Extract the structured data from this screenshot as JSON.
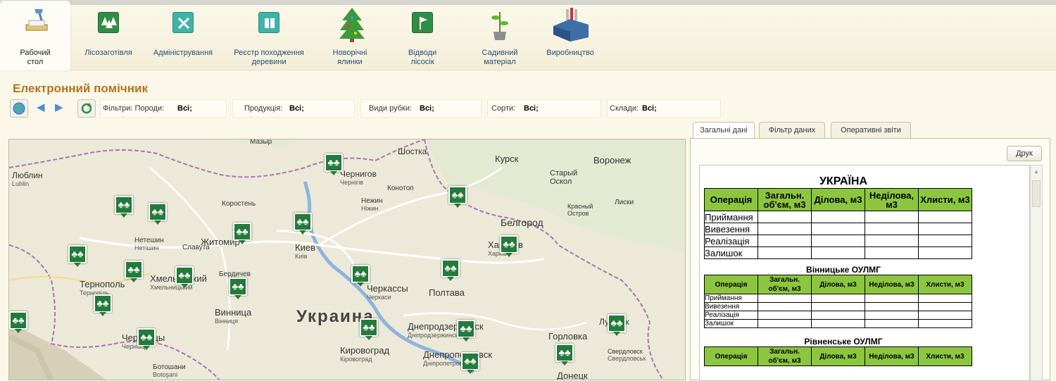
{
  "toolbar": [
    {
      "label": "Рабочий\nстол",
      "icon": "desk-lamp-icon"
    },
    {
      "label": "Лісозаготівля",
      "icon": "forest-icon"
    },
    {
      "label": "Адміністрування",
      "icon": "tools-icon"
    },
    {
      "label": "Реєстр походження\nдеревини",
      "icon": "registry-icon"
    },
    {
      "label": "Новорічні\nялинки",
      "icon": "christmas-tree-icon"
    },
    {
      "label": "Відводи\nлісосік",
      "icon": "flag-icon"
    },
    {
      "label": "Садивний\nматеріал",
      "icon": "seedling-icon"
    },
    {
      "label": "Виробництво",
      "icon": "factory-icon"
    }
  ],
  "title": "Електронний помічник",
  "filters": {
    "label_poroda": "Фільтри: Породи:",
    "value_poroda": "Всі;",
    "label_produkcia": "Продукція:",
    "value_produkcia": "Всі;",
    "label_rubky": "Види рубки:",
    "value_rubky": "Всі;",
    "label_sorty": "Сорти:",
    "value_sorty": "Всі;",
    "label_sklady": "Склади:",
    "value_sklady": "Всі;"
  },
  "tabs": [
    "Загальні дані",
    "Фільтр даних",
    "Оперативні звіти"
  ],
  "print_button": "Друк",
  "report": {
    "country": "УКРАЇНА",
    "headers": [
      "Операція",
      "Загальн. об'єм, м3",
      "Ділова, м3",
      "Неділова, м3",
      "Хлисти, м3"
    ],
    "rows": [
      "Приймання",
      "Вивезення",
      "Реалізація",
      "Залишок"
    ],
    "regions": [
      "Вінницьке ОУЛМГ",
      "Рівненське ОУЛМГ"
    ]
  },
  "map": {
    "country_label": "Украина",
    "cities": [
      {
        "name": "Люблин",
        "sub": "Lublin"
      },
      {
        "name": "Чернигов",
        "sub": "Чернігів"
      },
      {
        "name": "Шостка",
        "sub": ""
      },
      {
        "name": "Курск",
        "sub": ""
      },
      {
        "name": "Воронеж",
        "sub": ""
      },
      {
        "name": "Старый Оскол",
        "sub": ""
      },
      {
        "name": "Конотоп",
        "sub": ""
      },
      {
        "name": "Нежин",
        "sub": "Ніжин"
      },
      {
        "name": "Коростень",
        "sub": ""
      },
      {
        "name": "Красный Остров",
        "sub": ""
      },
      {
        "name": "Лиски",
        "sub": ""
      },
      {
        "name": "Белгород",
        "sub": ""
      },
      {
        "name": "Нетешин",
        "sub": "Нетішин"
      },
      {
        "name": "Славута",
        "sub": ""
      },
      {
        "name": "Житомир",
        "sub": ""
      },
      {
        "name": "Киев",
        "sub": "Київ"
      },
      {
        "name": "Харьков",
        "sub": "Харків"
      },
      {
        "name": "Тернополь",
        "sub": "Тернопіль"
      },
      {
        "name": "Хмельницкий",
        "sub": "Хмельницький"
      },
      {
        "name": "Бердичев",
        "sub": ""
      },
      {
        "name": "Черкассы",
        "sub": "Черкаси"
      },
      {
        "name": "Полтава",
        "sub": ""
      },
      {
        "name": "Винница",
        "sub": "Вінниця"
      },
      {
        "name": "Днепродзержинск",
        "sub": "Дніпродзержинськ"
      },
      {
        "name": "Горловка",
        "sub": ""
      },
      {
        "name": "Черновцы",
        "sub": "Чернівці"
      },
      {
        "name": "Кировоград",
        "sub": "Кіровоград"
      },
      {
        "name": "Днепропетровск",
        "sub": "Дніпропетровськ"
      },
      {
        "name": "Свердловск",
        "sub": "Свердловськ"
      },
      {
        "name": "Донецк",
        "sub": ""
      },
      {
        "name": "Ботошани",
        "sub": "Botoşani"
      },
      {
        "name": "Луганск",
        "sub": ""
      },
      {
        "name": "Мазыр",
        "sub": ""
      }
    ]
  }
}
